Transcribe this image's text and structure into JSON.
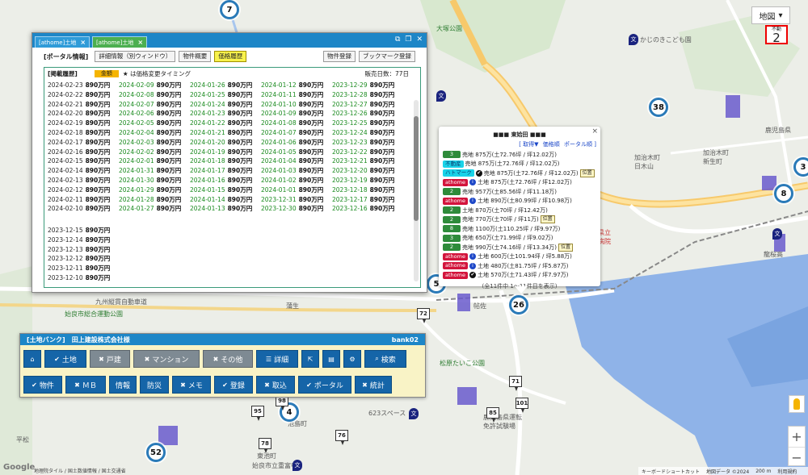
{
  "map": {
    "type_label": "地図",
    "fudo_badge": {
      "label": "不動",
      "value": "2"
    },
    "labels": {
      "kodomo": "かじのきこども園",
      "kagoshima": "鹿児島県",
      "kajiki": "加治木町\n新生町",
      "kitayama": "加治木町\n日木山",
      "aira": "姶良市",
      "station": "帖佐",
      "hospital": "県立\n病院",
      "ryuoukan": "龍桜高",
      "taiko": "松原たいこ公園",
      "sports": "623スペース",
      "kenritsu": "鹿児島県運転\n免許試験場",
      "kamiya": "池島町",
      "higashi": "東池町",
      "hiramatsu": "平松",
      "uchi": "始良市総合運動公園",
      "school": "始良市立重富中",
      "road": "九州縦貫自動車道",
      "stop": "蒲生",
      "kou": "大塚公園"
    },
    "clusters": [
      "7",
      "38",
      "3",
      "8",
      "26",
      "4",
      "52",
      "5"
    ],
    "pins": [
      "72",
      "71",
      "101",
      "85",
      "98",
      "95",
      "78",
      "76"
    ],
    "footer": {
      "shortcut": "キーボードショートカット",
      "data": "地図データ ©2024",
      "scale": "200 m",
      "terms": "利用規約"
    },
    "google": "Google",
    "attrib": "地理院タイル / 国土数値情報 / 国土交通省"
  },
  "history_window": {
    "tabs": [
      {
        "label": "[athome]土地",
        "active": false
      },
      {
        "label": "[athome]土地",
        "active": true
      }
    ],
    "portal_label": "[ポータル情報]",
    "buttons": [
      "詳細情報（別ウィンドウ）",
      "物件概要",
      "価格履歴"
    ],
    "right_buttons": [
      "物件登録",
      "ブックマーク登録"
    ],
    "section_title": "[掲載履歴]",
    "legend_tag": "金額",
    "legend_text": "★ は価格変更タイミング",
    "sale_days": "販売日数：77日",
    "columns": [
      {
        "tone": "normal",
        "entries": [
          {
            "date": "2024-02-23",
            "price": "890万円"
          },
          {
            "date": "2024-02-22",
            "price": "890万円"
          },
          {
            "date": "2024-02-21",
            "price": "890万円"
          },
          {
            "date": "2024-02-20",
            "price": "890万円"
          },
          {
            "date": "2024-02-19",
            "price": "890万円"
          },
          {
            "date": "2024-02-18",
            "price": "890万円"
          },
          {
            "date": "2024-02-17",
            "price": "890万円"
          },
          {
            "date": "2024-02-16",
            "price": "890万円"
          },
          {
            "date": "2024-02-15",
            "price": "890万円"
          },
          {
            "date": "2024-02-14",
            "price": "890万円"
          },
          {
            "date": "2024-02-13",
            "price": "890万円"
          },
          {
            "date": "2024-02-12",
            "price": "890万円"
          },
          {
            "date": "2024-02-11",
            "price": "890万円"
          },
          {
            "date": "2024-02-10",
            "price": "890万円"
          }
        ]
      },
      {
        "tone": "green",
        "entries": [
          {
            "date": "2024-02-09",
            "price": "890万円"
          },
          {
            "date": "2024-02-08",
            "price": "890万円"
          },
          {
            "date": "2024-02-07",
            "price": "890万円"
          },
          {
            "date": "2024-02-06",
            "price": "890万円"
          },
          {
            "date": "2024-02-05",
            "price": "890万円"
          },
          {
            "date": "2024-02-04",
            "price": "890万円"
          },
          {
            "date": "2024-02-03",
            "price": "890万円"
          },
          {
            "date": "2024-02-02",
            "price": "890万円"
          },
          {
            "date": "2024-02-01",
            "price": "890万円"
          },
          {
            "date": "2024-01-31",
            "price": "890万円"
          },
          {
            "date": "2024-01-30",
            "price": "890万円"
          },
          {
            "date": "2024-01-29",
            "price": "890万円"
          },
          {
            "date": "2024-01-28",
            "price": "890万円"
          },
          {
            "date": "2024-01-27",
            "price": "890万円"
          }
        ]
      },
      {
        "tone": "green",
        "entries": [
          {
            "date": "2024-01-26",
            "price": "890万円"
          },
          {
            "date": "2024-01-25",
            "price": "890万円"
          },
          {
            "date": "2024-01-24",
            "price": "890万円"
          },
          {
            "date": "2024-01-23",
            "price": "890万円"
          },
          {
            "date": "2024-01-22",
            "price": "890万円"
          },
          {
            "date": "2024-01-21",
            "price": "890万円"
          },
          {
            "date": "2024-01-20",
            "price": "890万円"
          },
          {
            "date": "2024-01-19",
            "price": "890万円"
          },
          {
            "date": "2024-01-18",
            "price": "890万円"
          },
          {
            "date": "2024-01-17",
            "price": "890万円"
          },
          {
            "date": "2024-01-16",
            "price": "890万円"
          },
          {
            "date": "2024-01-15",
            "price": "890万円"
          },
          {
            "date": "2024-01-14",
            "price": "890万円"
          },
          {
            "date": "2024-01-13",
            "price": "890万円"
          }
        ]
      },
      {
        "tone": "green",
        "entries": [
          {
            "date": "2024-01-12",
            "price": "890万円"
          },
          {
            "date": "2024-01-11",
            "price": "890万円"
          },
          {
            "date": "2024-01-10",
            "price": "890万円"
          },
          {
            "date": "2024-01-09",
            "price": "890万円"
          },
          {
            "date": "2024-01-08",
            "price": "890万円"
          },
          {
            "date": "2024-01-07",
            "price": "890万円"
          },
          {
            "date": "2024-01-06",
            "price": "890万円"
          },
          {
            "date": "2024-01-05",
            "price": "890万円"
          },
          {
            "date": "2024-01-04",
            "price": "890万円"
          },
          {
            "date": "2024-01-03",
            "price": "890万円"
          },
          {
            "date": "2024-01-02",
            "price": "890万円"
          },
          {
            "date": "2024-01-01",
            "price": "890万円"
          },
          {
            "date": "2023-12-31",
            "price": "890万円"
          },
          {
            "date": "2023-12-30",
            "price": "890万円"
          }
        ]
      },
      {
        "tone": "green",
        "entries": [
          {
            "date": "2023-12-29",
            "price": "890万円"
          },
          {
            "date": "2023-12-28",
            "price": "890万円"
          },
          {
            "date": "2023-12-27",
            "price": "890万円"
          },
          {
            "date": "2023-12-26",
            "price": "890万円"
          },
          {
            "date": "2023-12-25",
            "price": "890万円"
          },
          {
            "date": "2023-12-24",
            "price": "890万円"
          },
          {
            "date": "2023-12-23",
            "price": "890万円"
          },
          {
            "date": "2023-12-22",
            "price": "890万円"
          },
          {
            "date": "2023-12-21",
            "price": "890万円"
          },
          {
            "date": "2023-12-20",
            "price": "890万円"
          },
          {
            "date": "2023-12-19",
            "price": "890万円"
          },
          {
            "date": "2023-12-18",
            "price": "890万円"
          },
          {
            "date": "2023-12-17",
            "price": "890万円"
          },
          {
            "date": "2023-12-16",
            "price": "890万円"
          }
        ]
      }
    ],
    "tail_entries": [
      {
        "date": "2023-12-15",
        "price": "890万円"
      },
      {
        "date": "2023-12-14",
        "price": "890万円"
      },
      {
        "date": "2023-12-13",
        "price": "890万円"
      },
      {
        "date": "2023-12-12",
        "price": "890万円"
      },
      {
        "date": "2023-12-11",
        "price": "890万円"
      },
      {
        "date": "2023-12-10",
        "price": "890万円"
      }
    ]
  },
  "popup": {
    "title": "■■■ 東姶田 ■■■",
    "links": [
      "[ 取得▼",
      "価格順",
      "ポータル順 ]"
    ],
    "rows": [
      {
        "tag": "3",
        "color": "green",
        "icon": "",
        "text": "売地 875万(土72.76坪 / 坪12.02万)",
        "chip": ""
      },
      {
        "tag": "不動産",
        "color": "cyan",
        "icon": "",
        "text": "売地 875万(土72.76坪 / 坪12.02万)",
        "chip": ""
      },
      {
        "tag": "ハトマーク",
        "color": "cyan",
        "icon": "✔",
        "text": "売地 875万(土72.76坪 / 坪12.02万)",
        "chip": "位置"
      },
      {
        "tag": "athome",
        "color": "red",
        "icon": "i",
        "text": "土地 875万(土72.76坪 / 坪12.02万)",
        "chip": ""
      },
      {
        "tag": "2",
        "color": "green",
        "icon": "",
        "text": "売地 957万(土85.56坪 / 坪11.18万)",
        "chip": ""
      },
      {
        "tag": "athome",
        "color": "red",
        "icon": "i",
        "text": "土地 890万(土80.99坪 / 坪10.98万)",
        "chip": ""
      },
      {
        "tag": "2",
        "color": "green",
        "icon": "",
        "text": "土地 870万(土70坪 / 坪12.42万)",
        "chip": ""
      },
      {
        "tag": "2",
        "color": "green",
        "icon": "",
        "text": "売地 770万(土70坪 / 坪11万)",
        "chip": "位置"
      },
      {
        "tag": "8",
        "color": "green",
        "icon": "",
        "text": "売地 1100万(土110.25坪 / 坪9.97万)",
        "chip": ""
      },
      {
        "tag": "3",
        "color": "green",
        "icon": "",
        "text": "売地 650万(土71.99坪 / 坪9.02万)",
        "chip": ""
      },
      {
        "tag": "2",
        "color": "green",
        "icon": "",
        "text": "売地 990万(土74.16坪 / 坪13.34万)",
        "chip": "位置"
      },
      {
        "tag": "athome",
        "color": "red",
        "icon": "i",
        "text": "土地 600万(土101.94坪 / 坪5.88万)",
        "chip": ""
      },
      {
        "tag": "athome",
        "color": "red",
        "icon": "i",
        "text": "土地 480万(土81.75坪 / 坪5.87万)",
        "chip": ""
      },
      {
        "tag": "athome",
        "color": "red",
        "icon": "✔",
        "text": "土地 570万(土71.43坪 / 坪7.97万)",
        "chip": ""
      }
    ],
    "footer": "(全11件中 1〜11件目を表示)"
  },
  "panel": {
    "title": "[土地バンク]　田上建設株式会社様",
    "user": "bank02",
    "row1": [
      {
        "label": "",
        "icon": "⌂",
        "off": false,
        "w": 22,
        "name": "home-button"
      },
      {
        "label": "土地",
        "icon": "✔",
        "off": false,
        "w": 52,
        "name": "land-button"
      },
      {
        "label": "戸建",
        "icon": "✖",
        "off": true,
        "w": 50,
        "name": "house-button"
      },
      {
        "label": "マンション",
        "icon": "✖",
        "off": true,
        "w": 82,
        "name": "mansion-button"
      },
      {
        "label": "その他",
        "icon": "✖",
        "off": true,
        "w": 62,
        "name": "other-button"
      },
      {
        "label": "詳細",
        "icon": "☰",
        "off": false,
        "w": 52,
        "name": "detail-button"
      },
      {
        "label": "",
        "icon": "⇱",
        "off": false,
        "w": 22,
        "name": "external-button"
      },
      {
        "label": "",
        "icon": "▤",
        "off": false,
        "w": 22,
        "name": "document-button"
      },
      {
        "label": "",
        "icon": "⚙",
        "off": false,
        "w": 22,
        "name": "settings-button"
      },
      {
        "label": "検索",
        "icon": "⌕",
        "off": false,
        "w": 52,
        "name": "search-button"
      }
    ],
    "row2": [
      {
        "label": "物件",
        "icon": "✔",
        "off": false,
        "w": 48,
        "name": "property-button"
      },
      {
        "label": "ＭＢ",
        "icon": "✖",
        "off": false,
        "w": 50,
        "name": "mb-button"
      },
      {
        "label": "情報",
        "icon": "",
        "off": false,
        "w": 34,
        "name": "info-button"
      },
      {
        "label": "防災",
        "icon": "",
        "off": false,
        "w": 36,
        "name": "disaster-button"
      },
      {
        "label": "メモ",
        "icon": "✖",
        "off": false,
        "w": 48,
        "name": "memo-button"
      },
      {
        "label": "登録",
        "icon": "✔",
        "off": false,
        "w": 48,
        "name": "register-button"
      },
      {
        "label": "取込",
        "icon": "✖",
        "off": false,
        "w": 48,
        "name": "import-button"
      },
      {
        "label": "ポータル",
        "icon": "✔",
        "off": false,
        "w": 66,
        "name": "portal-button"
      },
      {
        "label": "統計",
        "icon": "✖",
        "off": false,
        "w": 46,
        "name": "stats-button"
      }
    ]
  }
}
